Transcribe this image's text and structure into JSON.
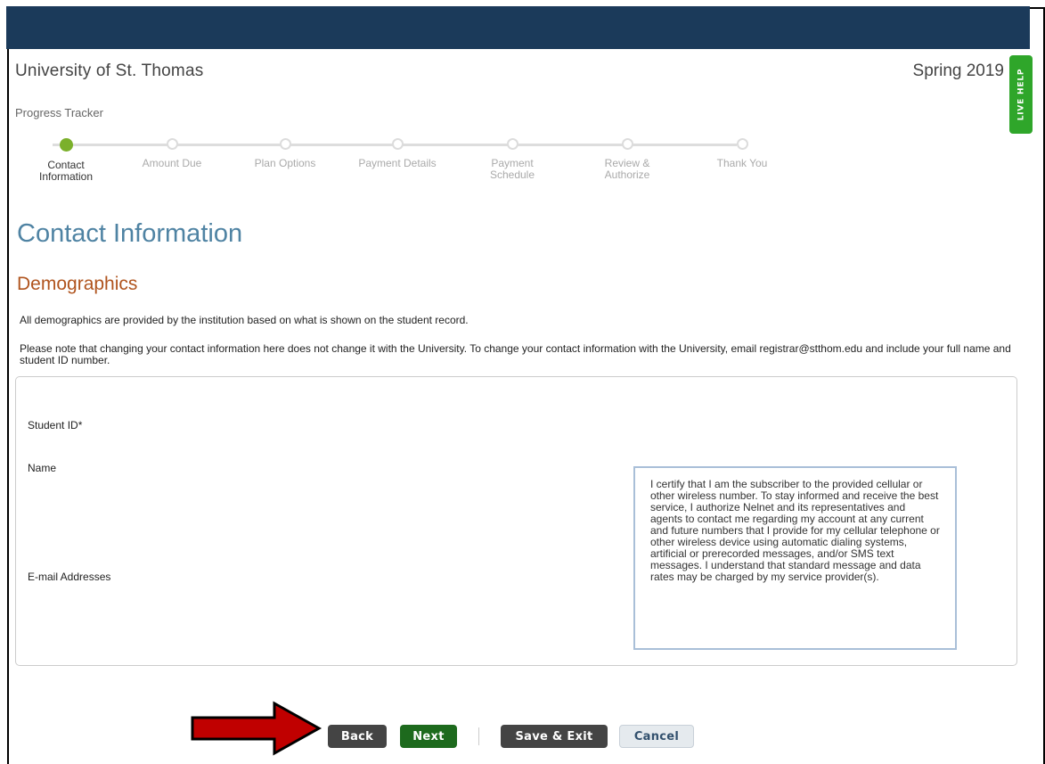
{
  "header": {
    "school": "University of St. Thomas",
    "term": "Spring 2019",
    "live_help": "LIVE HELP"
  },
  "tracker": {
    "title": "Progress Tracker",
    "steps": [
      {
        "label": "Contact Information",
        "active": true
      },
      {
        "label": "Amount Due",
        "active": false
      },
      {
        "label": "Plan Options",
        "active": false
      },
      {
        "label": "Payment Details",
        "active": false
      },
      {
        "label": "Payment Schedule",
        "active": false
      },
      {
        "label": "Review & Authorize",
        "active": false
      },
      {
        "label": "Thank You",
        "active": false
      }
    ]
  },
  "main": {
    "title": "Contact Information",
    "section": "Demographics",
    "intro": "All demographics are provided by the institution based on what is shown on the student record.",
    "note": "Please note that changing your contact information here does not change it with the University. To change your contact information with the University, email registrar@stthom.edu and include your full name and student ID number.",
    "fields": {
      "student_id": "Student ID*",
      "name": "Name",
      "email": "E-mail Addresses"
    },
    "consent": "I certify that I am the subscriber to the provided cellular or other wireless number. To stay informed and receive the best service, I authorize Nelnet and its representatives and agents to contact me regarding my account at any current and future numbers that I provide for my cellular telephone or other wireless device using automatic dialing systems, artificial or prerecorded messages, and/or SMS text messages. I understand that standard message and data rates may be charged by my service provider(s)."
  },
  "actions": {
    "back": "Back",
    "next": "Next",
    "save_exit": "Save & Exit",
    "cancel": "Cancel"
  },
  "colors": {
    "header_bar": "#1b3a5a",
    "active_step": "#7bb02b",
    "title": "#4f83a3",
    "section": "#b0541e",
    "next_button": "#1d6a1d",
    "live_help": "#2fa62a",
    "annotation_arrow": "#c00000"
  }
}
